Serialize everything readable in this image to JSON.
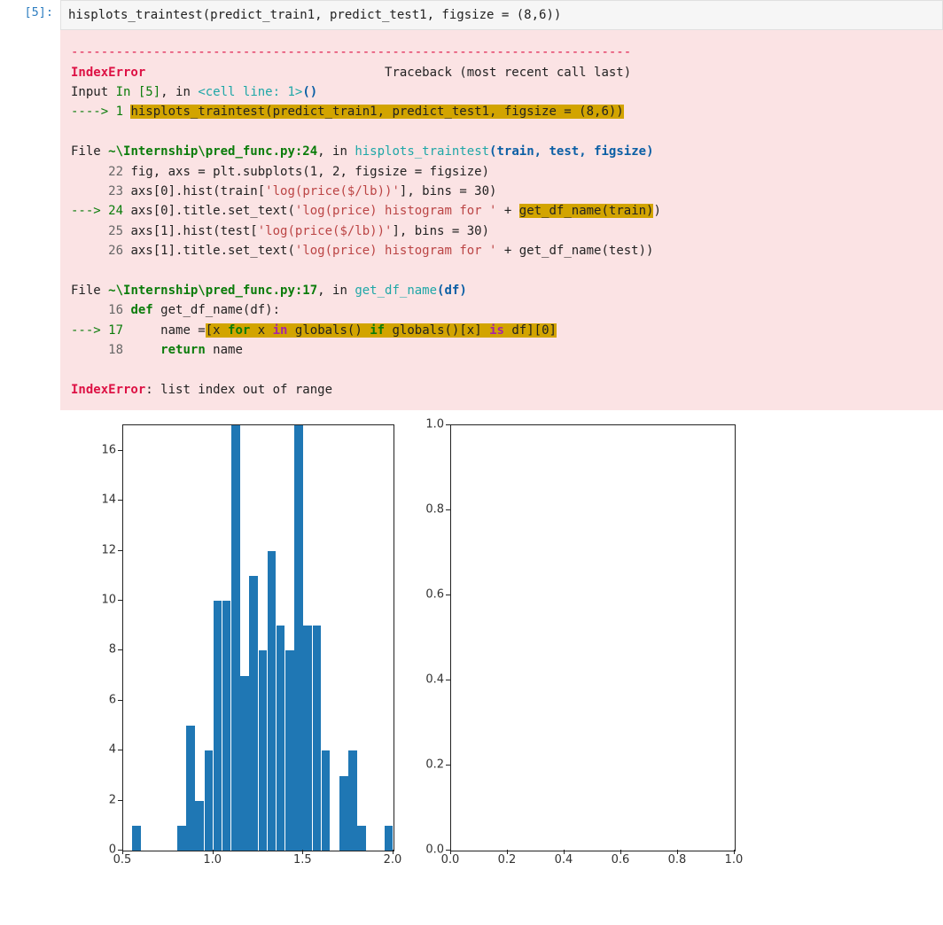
{
  "cell": {
    "prompt": "[5]:",
    "code": "hisplots_traintest(predict_train1, predict_test1, figsize = (8,6))"
  },
  "traceback": {
    "sep": "---------------------------------------------------------------------------",
    "err_name": "IndexError",
    "tb_header": "Traceback (most recent call last)",
    "l_input_prefix": "Input ",
    "l_input_in": "In [5]",
    "l_input_mid": ", in ",
    "l_input_cell": "<cell line: 1>",
    "l_input_paren": "()",
    "arrow1": "----> 1 ",
    "hl1": "hisplots_traintest(predict_train1, predict_test1, figsize = (8,6))",
    "file1": "File ",
    "file1_path": "~\\Internship\\pred_func.py:24",
    "file1_mid": ", in ",
    "file1_func": "hisplots_traintest",
    "file1_args_open": "(",
    "file1_arg1": "train",
    "file1_comma1": ", ",
    "file1_arg2": "test",
    "file1_comma2": ", ",
    "file1_arg3": "figsize",
    "file1_args_close": ")",
    "ln22": "     22",
    "code22": " fig, axs = plt.subplots(1, 2, figsize = figsize)",
    "ln23": "     23",
    "code23a": " axs[0].hist(train[",
    "code23s": "'log(price($/lb))'",
    "code23b": "], bins = 30)",
    "arrow24": "---> 24",
    "code24a": " axs[0].title.set_text(",
    "code24s": "'log(price) histogram for '",
    "code24b": " + ",
    "hl24": "get_df_name(train)",
    "code24c": ")",
    "ln25": "     25",
    "code25a": " axs[1].hist(test[",
    "code25s": "'log(price($/lb))'",
    "code25b": "], bins = 30)",
    "ln26": "     26",
    "code26a": " axs[1].title.set_text(",
    "code26s": "'log(price) histogram for '",
    "code26b": " + get_df_name(test))",
    "file2": "File ",
    "file2_path": "~\\Internship\\pred_func.py:17",
    "file2_mid": ", in ",
    "file2_func": "get_df_name",
    "file2_args_open": "(",
    "file2_arg1": "df",
    "file2_args_close": ")",
    "ln16": "     16",
    "code16a": " ",
    "code16_def": "def",
    "code16b": " get_df_name(df):",
    "arrow17": "---> 17",
    "code17a": "     name =",
    "hl17a": "[x ",
    "hl17_for": "for",
    "hl17b": " x ",
    "hl17_in": "in",
    "hl17c": " globals() ",
    "hl17_if": "if",
    "hl17d": " globals()[x] ",
    "hl17_is": "is",
    "hl17e": " df][0]",
    "ln18": "     18",
    "code18a": "     ",
    "code18_ret": "return",
    "code18b": " name",
    "final_err": "IndexError",
    "final_msg": ": list index out of range"
  },
  "chart_data": [
    {
      "type": "bar",
      "axes_index": 0,
      "title": "",
      "xlabel": "",
      "ylabel": "",
      "xlim": [
        0.5,
        2.0
      ],
      "ylim": [
        0,
        17
      ],
      "x_ticks": [
        0.5,
        1.0,
        1.5,
        2.0
      ],
      "y_ticks": [
        0,
        2,
        4,
        6,
        8,
        10,
        12,
        14,
        16
      ],
      "bins": 30,
      "bin_width": 0.05,
      "bars": [
        {
          "x": 0.55,
          "h": 1
        },
        {
          "x": 0.8,
          "h": 1
        },
        {
          "x": 0.85,
          "h": 5
        },
        {
          "x": 0.9,
          "h": 2
        },
        {
          "x": 0.95,
          "h": 4
        },
        {
          "x": 1.0,
          "h": 10
        },
        {
          "x": 1.05,
          "h": 10
        },
        {
          "x": 1.1,
          "h": 17
        },
        {
          "x": 1.15,
          "h": 7
        },
        {
          "x": 1.2,
          "h": 11
        },
        {
          "x": 1.25,
          "h": 8
        },
        {
          "x": 1.3,
          "h": 12
        },
        {
          "x": 1.35,
          "h": 9
        },
        {
          "x": 1.4,
          "h": 8
        },
        {
          "x": 1.45,
          "h": 17
        },
        {
          "x": 1.5,
          "h": 9
        },
        {
          "x": 1.55,
          "h": 9
        },
        {
          "x": 1.6,
          "h": 4
        },
        {
          "x": 1.65,
          "h": 0
        },
        {
          "x": 1.7,
          "h": 3
        },
        {
          "x": 1.75,
          "h": 4
        },
        {
          "x": 1.8,
          "h": 1
        },
        {
          "x": 1.85,
          "h": 0
        },
        {
          "x": 1.9,
          "h": 0
        },
        {
          "x": 1.95,
          "h": 1
        }
      ]
    },
    {
      "type": "bar",
      "axes_index": 1,
      "title": "",
      "xlabel": "",
      "ylabel": "",
      "xlim": [
        0.0,
        1.0
      ],
      "ylim": [
        0.0,
        1.0
      ],
      "x_ticks": [
        0.0,
        0.2,
        0.4,
        0.6,
        0.8,
        1.0
      ],
      "y_ticks": [
        0.0,
        0.2,
        0.4,
        0.6,
        0.8,
        1.0
      ],
      "bins": 30,
      "bars": []
    }
  ]
}
